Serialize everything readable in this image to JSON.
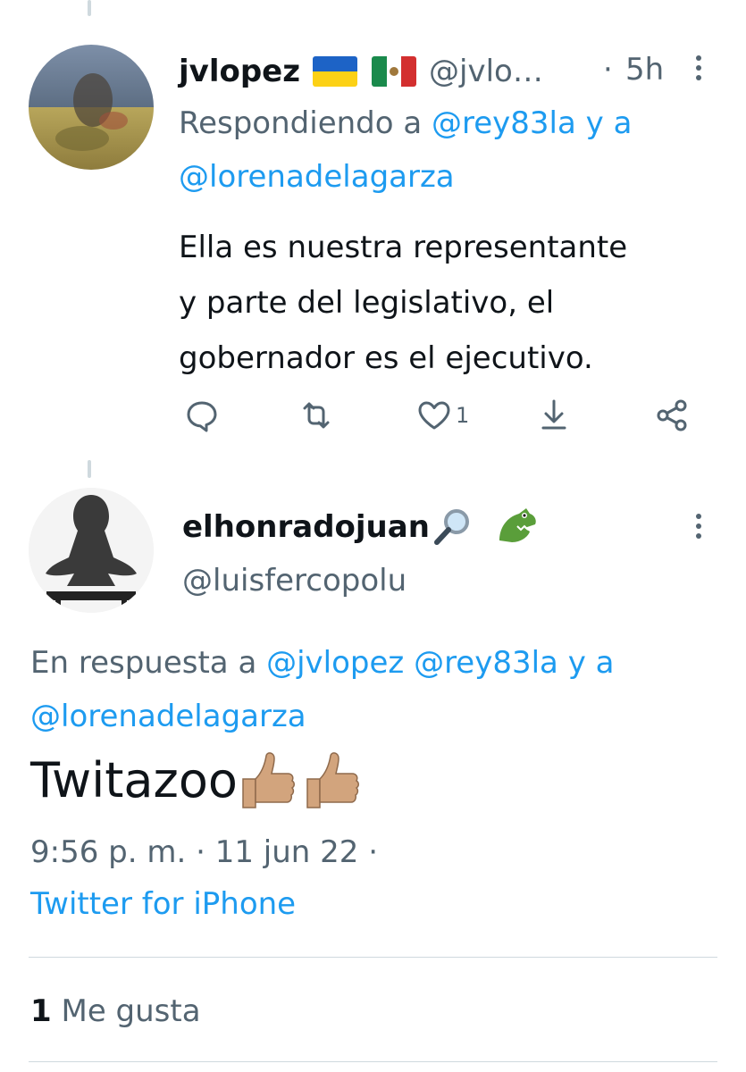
{
  "reply_tweet": {
    "author_name": "jvlopez",
    "handle": "@jvlo…",
    "time_sep": "·",
    "time": "5h",
    "replying_prefix": "Respondiendo a",
    "replying_user1": "@rey83la",
    "replying_joiner": "y a",
    "replying_user2": "@lorenadelagarza",
    "body_line1": "Ella es nuestra representante",
    "body_line2": "y parte del legislativo, el",
    "body_line3": "gobernador es el ejecutivo.",
    "like_count": "1"
  },
  "main_tweet": {
    "author_name": "elhonradojuan",
    "author_emojis": "🔎 🐊",
    "handle": "@luisfercopolu",
    "replying_prefix": "En respuesta a",
    "replying_user1": "@jvlopez",
    "replying_user2": "@rey83la",
    "replying_joiner": "y a",
    "replying_user3": "@lorenadelagarza",
    "body": "Twitazoo",
    "body_emoji": "👍🏼👍🏼",
    "time": "9:56 p. m.",
    "sep1": "·",
    "date": "11 jun 22",
    "sep2": "·",
    "source": "Twitter for iPhone",
    "likes_count": "1",
    "likes_label": "Me gusta"
  },
  "colors": {
    "link": "#1d9bf0",
    "secondary_text": "#536471",
    "primary_text": "#0f1419",
    "divider": "#cfd9de"
  },
  "icons": [
    "reply-icon",
    "retweet-icon",
    "like-icon",
    "share-download-icon",
    "share-icon",
    "more-icon"
  ]
}
